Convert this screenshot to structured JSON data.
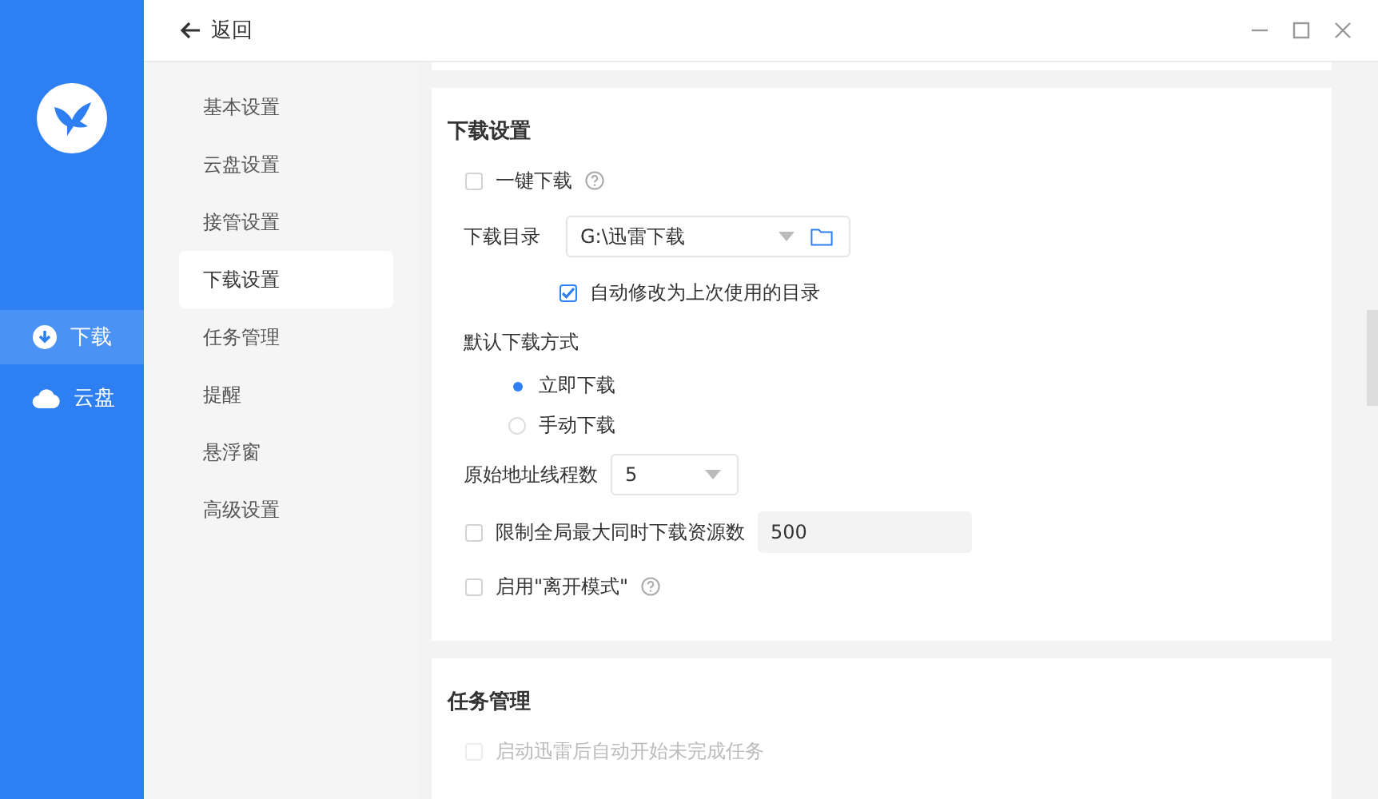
{
  "window": {
    "back": "返回"
  },
  "sidebar": {
    "items": [
      {
        "label": "下载",
        "selected": true
      },
      {
        "label": "云盘",
        "selected": false
      }
    ]
  },
  "settings_nav": {
    "items": [
      {
        "label": "基本设置",
        "selected": false
      },
      {
        "label": "云盘设置",
        "selected": false
      },
      {
        "label": "接管设置",
        "selected": false
      },
      {
        "label": "下载设置",
        "selected": true
      },
      {
        "label": "任务管理",
        "selected": false
      },
      {
        "label": "提醒",
        "selected": false
      },
      {
        "label": "悬浮窗",
        "selected": false
      },
      {
        "label": "高级设置",
        "selected": false
      }
    ]
  },
  "sections": [
    {
      "title": "下载设置",
      "rows": [
        {
          "kind": "checkbox",
          "label": "一键下载",
          "checked": false,
          "disabled": false,
          "help": true
        },
        {
          "kind": "path",
          "label": "下载目录",
          "value": "G:\\迅雷下载"
        },
        {
          "kind": "subcheck",
          "label": "自动修改为上次使用的目录",
          "checked": true,
          "disabled": false
        },
        {
          "kind": "heading",
          "label": "默认下载方式"
        },
        {
          "kind": "radio",
          "label": "立即下载",
          "selected": true
        },
        {
          "kind": "radio",
          "label": "手动下载",
          "selected": false
        },
        {
          "kind": "select",
          "label": "原始地址线程数",
          "value": "5"
        },
        {
          "kind": "checkinput",
          "label": "限制全局最大同时下载资源数",
          "checked": false,
          "disabled": false,
          "value": "500"
        },
        {
          "kind": "checkbox",
          "label": "启用\"离开模式\"",
          "checked": false,
          "disabled": false,
          "help": true
        }
      ]
    },
    {
      "title": "任务管理",
      "rows": [
        {
          "kind": "checkbox",
          "label": "启动迅雷后自动开始未完成任务",
          "checked": false,
          "disabled": true,
          "help": false
        }
      ]
    }
  ]
}
